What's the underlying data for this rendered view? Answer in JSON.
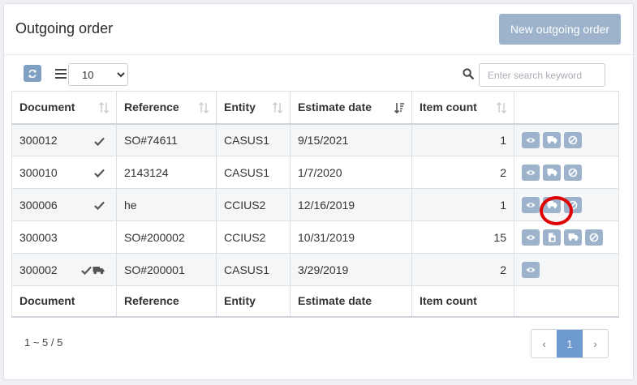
{
  "header": {
    "title": "Outgoing order",
    "new_button": "New outgoing order"
  },
  "toolbar": {
    "page_size": "10",
    "page_size_options": [
      "10"
    ],
    "search_placeholder": "Enter search keyword"
  },
  "table": {
    "columns": [
      "Document",
      "Reference",
      "Entity",
      "Estimate date",
      "Item count"
    ],
    "rows": [
      {
        "document": "300012",
        "reference": "SO#74611",
        "entity": "CASUS1",
        "date": "9/15/2021",
        "count": "1",
        "flags": [
          "check-icon"
        ],
        "actions": [
          "eye-icon",
          "truck-icon",
          "ban-icon"
        ]
      },
      {
        "document": "300010",
        "reference": "2143124",
        "entity": "CASUS1",
        "date": "1/7/2020",
        "count": "2",
        "flags": [
          "check-icon"
        ],
        "actions": [
          "eye-icon",
          "truck-icon",
          "ban-icon"
        ]
      },
      {
        "document": "300006",
        "reference": "he",
        "entity": "CCIUS2",
        "date": "12/16/2019",
        "count": "1",
        "flags": [
          "check-icon"
        ],
        "actions": [
          "eye-icon",
          "truck-icon",
          "ban-icon"
        ]
      },
      {
        "document": "300003",
        "reference": "SO#200002",
        "entity": "CCIUS2",
        "date": "10/31/2019",
        "count": "15",
        "flags": [],
        "actions": [
          "eye-icon",
          "copy-icon",
          "truck-icon",
          "ban-icon"
        ]
      },
      {
        "document": "300002",
        "reference": "SO#200001",
        "entity": "CASUS1",
        "date": "3/29/2019",
        "count": "2",
        "flags": [
          "check-icon",
          "truck-icon"
        ],
        "actions": [
          "eye-icon"
        ]
      }
    ]
  },
  "footer": {
    "range": "1 ~ 5 / 5",
    "prev": "‹",
    "current_page": "1",
    "next": "›"
  },
  "colors": {
    "button": "#9db3cc",
    "page_active": "#6e9ad0",
    "highlight": "#e00000"
  }
}
